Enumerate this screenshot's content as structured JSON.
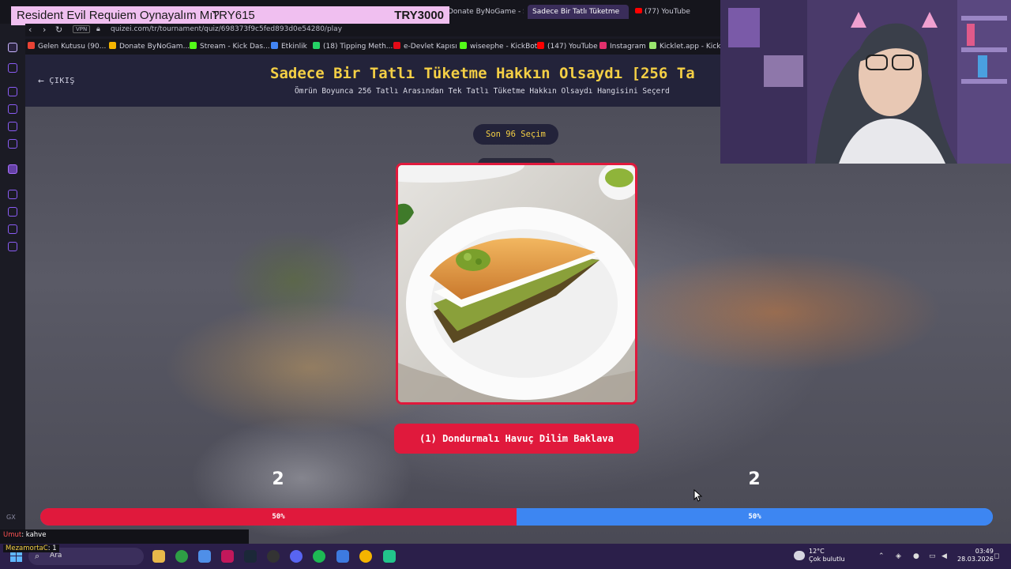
{
  "overlay": {
    "game_title": "Resident Evil Requiem Oynayalım Mı?",
    "current_amount": "TRY615",
    "goal_amount": "TRY3000"
  },
  "browser": {
    "tabs": [
      {
        "label": "Donate ByNoGame - Str"
      },
      {
        "label": "Sadece Bir Tatlı Tüketme"
      },
      {
        "label": "(77) YouTube"
      }
    ],
    "vpn_label": "VPN",
    "url": "quizei.com/tr/tournament/quiz/698373f9c5fed893d0e54280/play",
    "bookmarks": [
      {
        "label": "Gelen Kutusu (90...",
        "color": "#ea4335"
      },
      {
        "label": "Donate ByNoGam...",
        "color": "#f4b400"
      },
      {
        "label": "Stream - Kick Das...",
        "color": "#53fc18"
      },
      {
        "label": "Etkinlik",
        "color": "#4285f4"
      },
      {
        "label": "(18) Tipping Meth...",
        "color": "#25d366"
      },
      {
        "label": "e-Devlet Kapısı",
        "color": "#e30a17"
      },
      {
        "label": "wiseephe - KickBot",
        "color": "#53fc18"
      },
      {
        "label": "(147) YouTube",
        "color": "#ff0000"
      },
      {
        "label": "Instagram",
        "color": "#e1306c"
      },
      {
        "label": "Kicklet.app - Kick...",
        "color": "#9ae66e"
      }
    ],
    "sidebar_label": "GX"
  },
  "page": {
    "exit_label": "ÇIKIŞ",
    "title": "Sadece Bir Tatlı Tüketme Hakkın Olsaydı [256 Ta",
    "subtitle": "Ömrün Boyunca 256 Tatlı Arasından Tek Tatlı Tüketme Hakkın Olsaydı Hangisini Seçerd",
    "round_label": "Son 96 Seçim",
    "choice_label": "(1) Dondurmalı Havuç Dilim Baklava",
    "votes": {
      "left_count": "2",
      "right_count": "2",
      "left_percent_label": "50%",
      "right_percent_label": "50%",
      "left_fraction": 0.5
    },
    "colors": {
      "accent_red": "#e0193c",
      "accent_blue": "#3d86f2",
      "title_yellow": "#f4cf45"
    }
  },
  "chat": {
    "line1_user": "Umut",
    "line1_text": ": kahve",
    "line2_user": "MezamortaC",
    "line2_text": ": 1"
  },
  "taskbar": {
    "search_placeholder": "Ara",
    "weather_temp": "12°C",
    "weather_desc": "Çok bulutlu",
    "time": "03:49",
    "date": "28.03.2026"
  }
}
